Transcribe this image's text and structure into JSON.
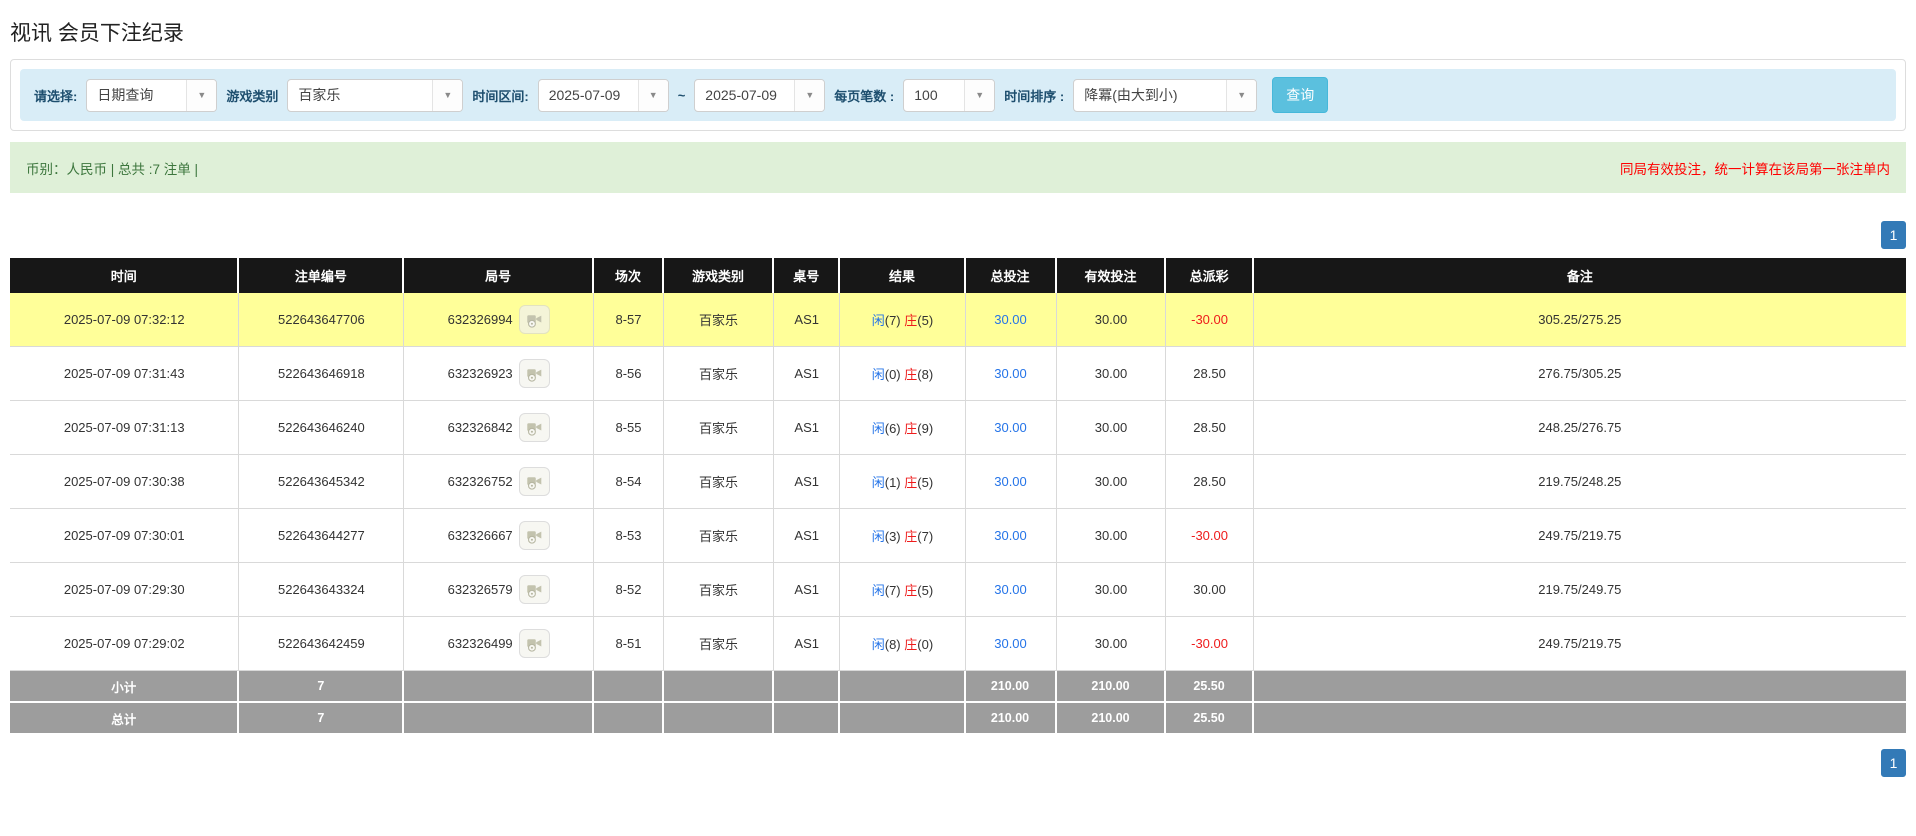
{
  "page": {
    "title": "视讯 会员下注纪录"
  },
  "filters": {
    "select_label": "请选择:",
    "select_value": "日期查询",
    "game_label": "游戏类别",
    "game_value": "百家乐",
    "range_label": "时间区间:",
    "date_from": "2025-07-09",
    "range_separator": "~",
    "date_to": "2025-07-09",
    "per_page_label": "每页笔数 :",
    "per_page_value": "100",
    "sort_label": "时间排序 :",
    "sort_value": "降冪(由大到小)",
    "search_button": "查询",
    "caret_glyph": "▼"
  },
  "summary": {
    "left": "币别：人民币 | 总共 :7 注单 |",
    "note": "同局有效投注，统一计算在该局第一张注单内"
  },
  "pagination": {
    "page": "1"
  },
  "table": {
    "headers": [
      "时间",
      "注单编号",
      "局号",
      "场次",
      "游戏类别",
      "桌号",
      "结果",
      "总投注",
      "有效投注",
      "总派彩",
      "备注"
    ],
    "rows": [
      {
        "time": "2025-07-09 07:32:12",
        "bet_id": "522643647706",
        "round_id": "632326994",
        "session": "8-57",
        "game": "百家乐",
        "table_no": "AS1",
        "result": {
          "p_label": "闲",
          "p_val": "(7)",
          "b_label": "庄",
          "b_val": "(5)"
        },
        "total_bet": "30.00",
        "valid_bet": "30.00",
        "payout": "-30.00",
        "note": "305.25/275.25"
      },
      {
        "time": "2025-07-09 07:31:43",
        "bet_id": "522643646918",
        "round_id": "632326923",
        "session": "8-56",
        "game": "百家乐",
        "table_no": "AS1",
        "result": {
          "p_label": "闲",
          "p_val": "(0)",
          "b_label": "庄",
          "b_val": "(8)"
        },
        "total_bet": "30.00",
        "valid_bet": "30.00",
        "payout": "28.50",
        "note": "276.75/305.25"
      },
      {
        "time": "2025-07-09 07:31:13",
        "bet_id": "522643646240",
        "round_id": "632326842",
        "session": "8-55",
        "game": "百家乐",
        "table_no": "AS1",
        "result": {
          "p_label": "闲",
          "p_val": "(6)",
          "b_label": "庄",
          "b_val": "(9)"
        },
        "total_bet": "30.00",
        "valid_bet": "30.00",
        "payout": "28.50",
        "note": "248.25/276.75"
      },
      {
        "time": "2025-07-09 07:30:38",
        "bet_id": "522643645342",
        "round_id": "632326752",
        "session": "8-54",
        "game": "百家乐",
        "table_no": "AS1",
        "result": {
          "p_label": "闲",
          "p_val": "(1)",
          "b_label": "庄",
          "b_val": "(5)"
        },
        "total_bet": "30.00",
        "valid_bet": "30.00",
        "payout": "28.50",
        "note": "219.75/248.25"
      },
      {
        "time": "2025-07-09 07:30:01",
        "bet_id": "522643644277",
        "round_id": "632326667",
        "session": "8-53",
        "game": "百家乐",
        "table_no": "AS1",
        "result": {
          "p_label": "闲",
          "p_val": "(3)",
          "b_label": "庄",
          "b_val": "(7)"
        },
        "total_bet": "30.00",
        "valid_bet": "30.00",
        "payout": "-30.00",
        "note": "249.75/219.75"
      },
      {
        "time": "2025-07-09 07:29:30",
        "bet_id": "522643643324",
        "round_id": "632326579",
        "session": "8-52",
        "game": "百家乐",
        "table_no": "AS1",
        "result": {
          "p_label": "闲",
          "p_val": "(7)",
          "b_label": "庄",
          "b_val": "(5)"
        },
        "total_bet": "30.00",
        "valid_bet": "30.00",
        "payout": "30.00",
        "note": "219.75/249.75"
      },
      {
        "time": "2025-07-09 07:29:02",
        "bet_id": "522643642459",
        "round_id": "632326499",
        "session": "8-51",
        "game": "百家乐",
        "table_no": "AS1",
        "result": {
          "p_label": "闲",
          "p_val": "(8)",
          "b_label": "庄",
          "b_val": "(0)"
        },
        "total_bet": "30.00",
        "valid_bet": "30.00",
        "payout": "-30.00",
        "note": "249.75/219.75"
      }
    ],
    "subtotal": {
      "label": "小计",
      "count": "7",
      "total_bet": "210.00",
      "valid_bet": "210.00",
      "payout": "25.50"
    },
    "total": {
      "label": "总计",
      "count": "7",
      "total_bet": "210.00",
      "valid_bet": "210.00",
      "payout": "25.50"
    }
  },
  "colors": {
    "filter_bar_bg": "#d9edf7",
    "filter_label": "#1d4e6e",
    "search_button_bg": "#5bc0de",
    "summary_bg": "#dff0d8",
    "summary_text": "#3c763d",
    "note_red": "#ff0000",
    "link_blue": "#2574e8",
    "loss_red": "#ee1c1c",
    "highlight_yellow": "#ffff99",
    "table_header_bg": "#171717",
    "table_footer_bg": "#9d9d9d",
    "pagination_blue": "#337ab7"
  }
}
